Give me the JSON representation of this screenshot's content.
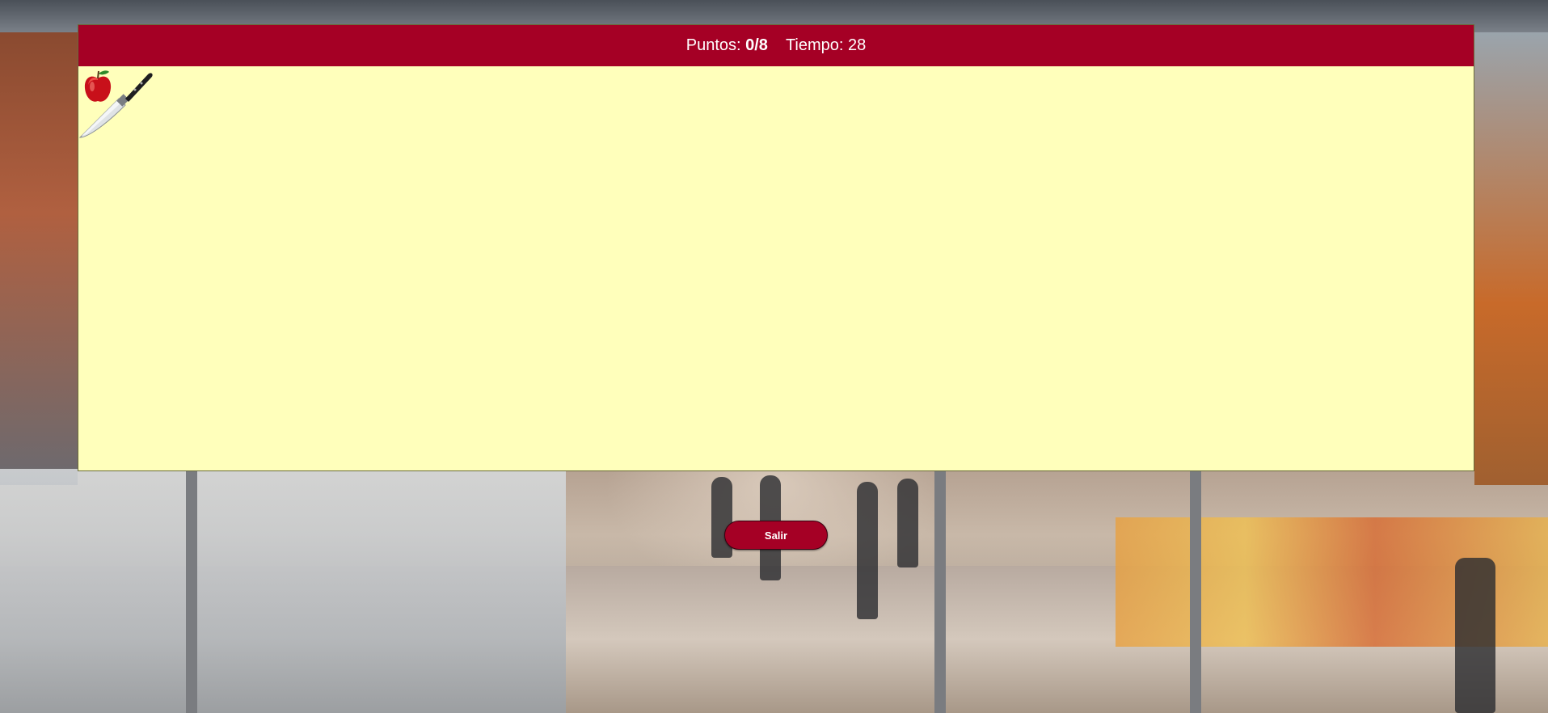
{
  "hud": {
    "score_label": "Puntos:",
    "score_value": "0/8",
    "time_label": "Tiempo:",
    "time_value": "28"
  },
  "play_area": {
    "items": [
      {
        "name": "apple",
        "icon": "apple-icon"
      },
      {
        "name": "knife",
        "icon": "knife-icon"
      }
    ]
  },
  "exit_button": {
    "label": "Salir"
  },
  "colors": {
    "header_bg": "#a50025",
    "panel_bg": "#ffffbb",
    "button_bg": "#a50025"
  }
}
